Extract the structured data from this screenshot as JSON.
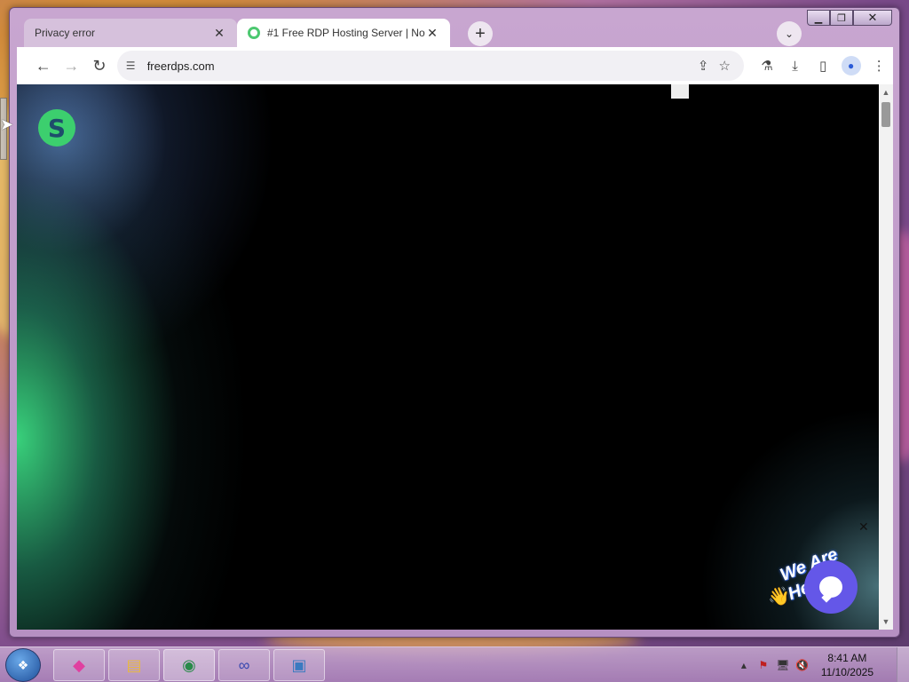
{
  "browser": {
    "tabs": [
      {
        "title": "Privacy error",
        "active": false
      },
      {
        "title": "#1 Free RDP Hosting Server | No",
        "active": true
      }
    ],
    "new_tab_label": "+",
    "address": "freerdps.com"
  },
  "page": {
    "logo_glyph": "S",
    "chat_label": "We Are Here!",
    "chat_wave": "👋",
    "chat_close": "✕"
  },
  "taskbar": {
    "clock_time": "8:41 AM",
    "clock_date": "11/10/2025"
  },
  "colors": {
    "window_frame": "#b690c2",
    "chat_button": "#6457e8",
    "logo_green": "#3ccf6e"
  },
  "icons": {
    "back": "arrow-left-icon",
    "forward": "arrow-right-icon",
    "reload": "reload-icon",
    "site_settings": "tune-icon",
    "share": "share-icon",
    "bookmark": "star-icon",
    "labs": "flask-icon",
    "downloads": "download-icon",
    "side_panel": "side-panel-icon",
    "profile": "profile-icon",
    "menu": "kebab-menu-icon"
  }
}
